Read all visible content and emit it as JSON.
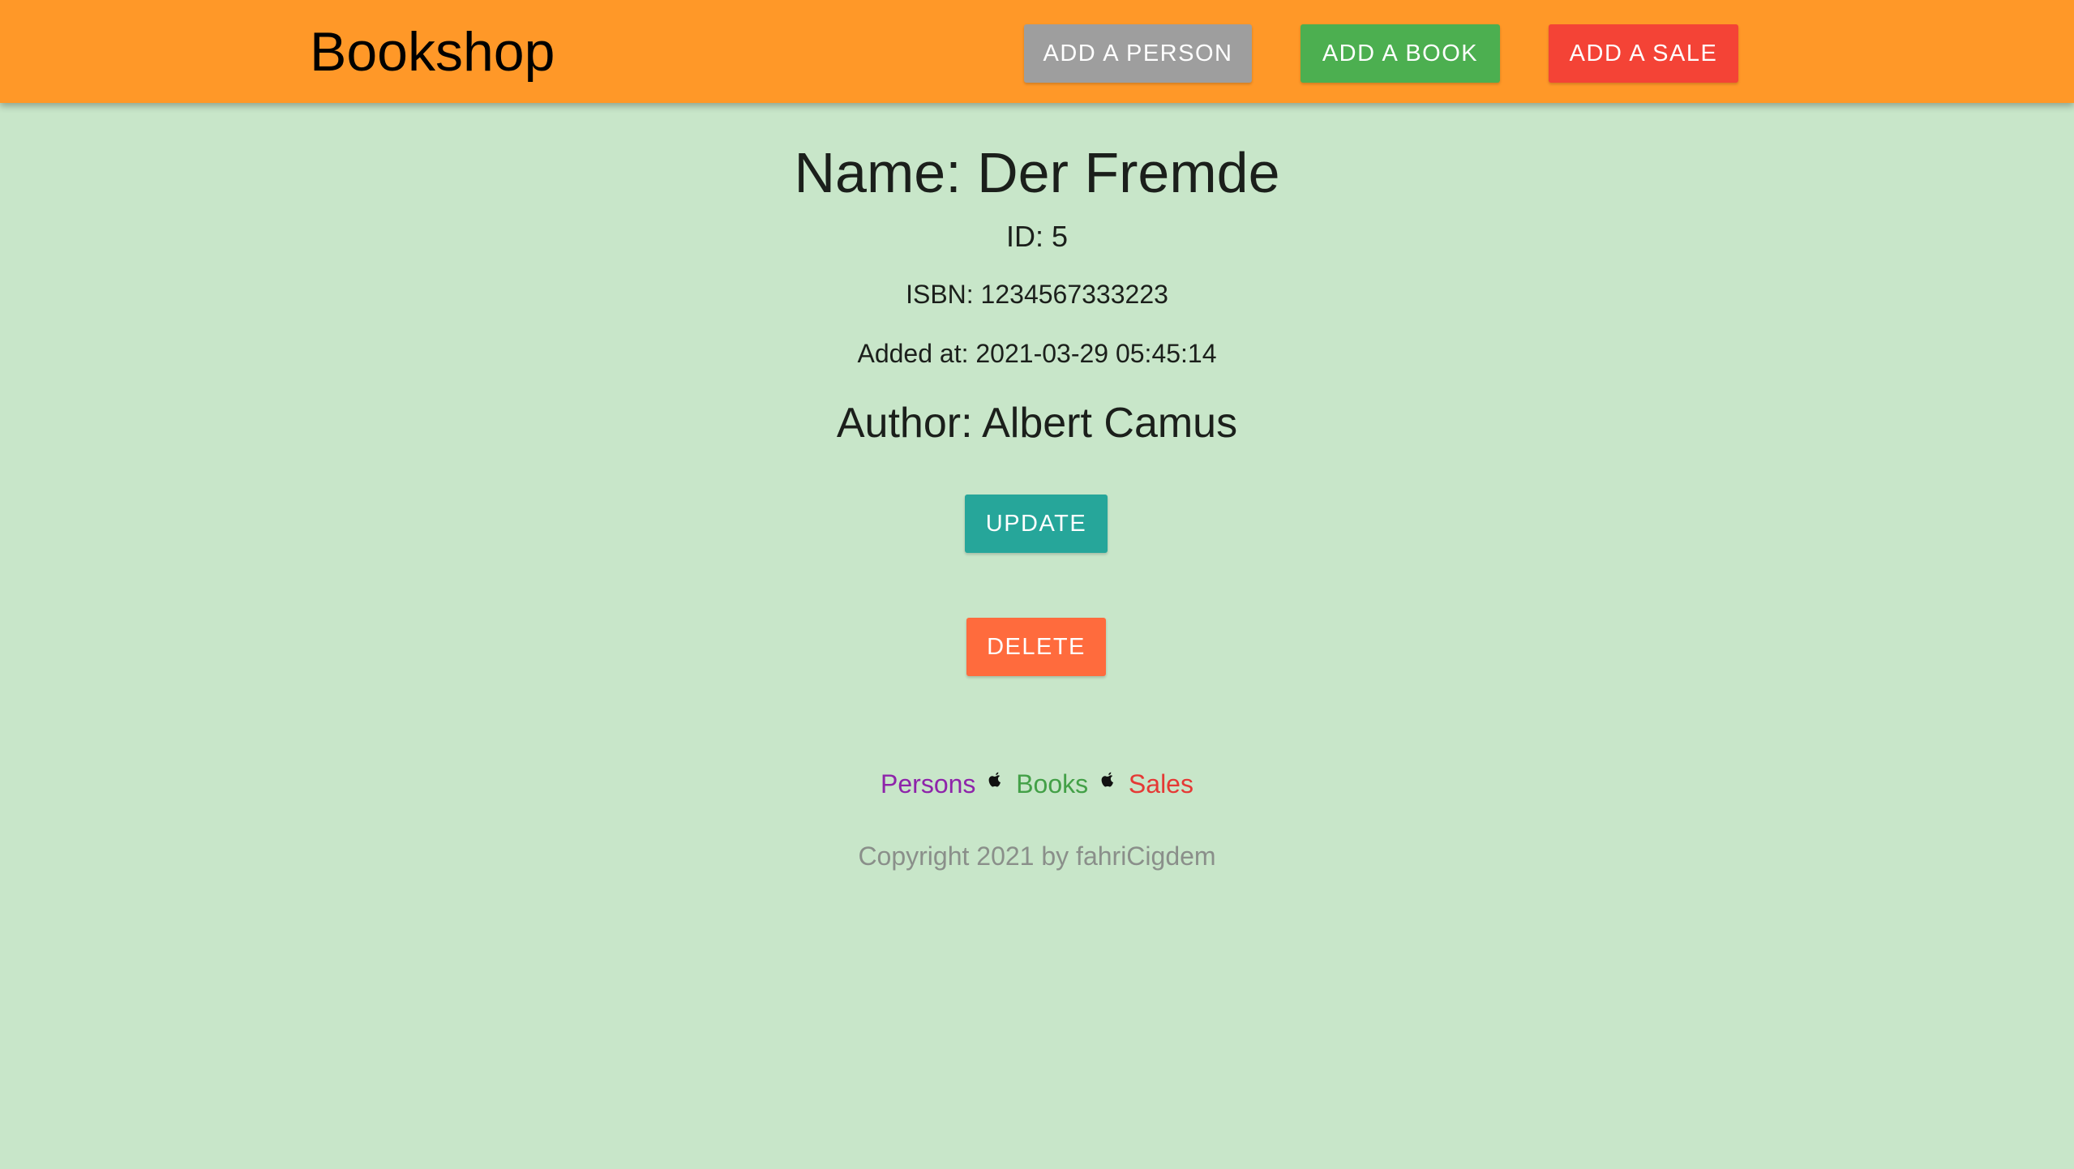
{
  "header": {
    "brand": "Bookshop",
    "add_person_label": "ADD A PERSON",
    "add_book_label": "ADD A BOOK",
    "add_sale_label": "ADD A SALE"
  },
  "book": {
    "name_line": "Name: Der Fremde",
    "id_line": "ID: 5",
    "isbn_line": "ISBN: 1234567333223",
    "added_line": "Added at: 2021-03-29 05:45:14",
    "author_line": "Author: Albert Camus"
  },
  "actions": {
    "update_label": "UPDATE",
    "delete_label": "DELETE"
  },
  "footer": {
    "links": {
      "persons": "Persons",
      "books": "Books",
      "sales": "Sales"
    },
    "separator_icon": "apple-icon",
    "copyright": "Copyright 2021 by fahriCigdem"
  },
  "colors": {
    "navbar": "#ff9828",
    "background": "#c8e6c9",
    "add_person": "#9e9e9e",
    "add_book": "#4caf50",
    "add_sale": "#f44336",
    "update": "#26a69a",
    "delete": "#ff6b3d",
    "link_persons": "#8e24aa",
    "link_books": "#43a047",
    "link_sales": "#e53935"
  }
}
